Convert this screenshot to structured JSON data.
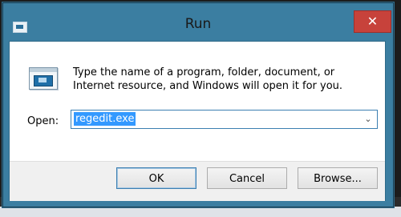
{
  "window": {
    "title": "Run",
    "close_glyph": "✕",
    "icon": "run-app-icon"
  },
  "dialog": {
    "description": "Type the name of a program, folder, document, or Internet resource, and Windows will open it for you.",
    "open_label": "Open:",
    "open_value": "regedit.exe",
    "dropdown_glyph": "⌄"
  },
  "buttons": {
    "ok": "OK",
    "cancel": "Cancel",
    "browse": "Browse..."
  },
  "colors": {
    "frame": "#3b7ea1",
    "close": "#c7423b",
    "selection": "#3399ff"
  }
}
